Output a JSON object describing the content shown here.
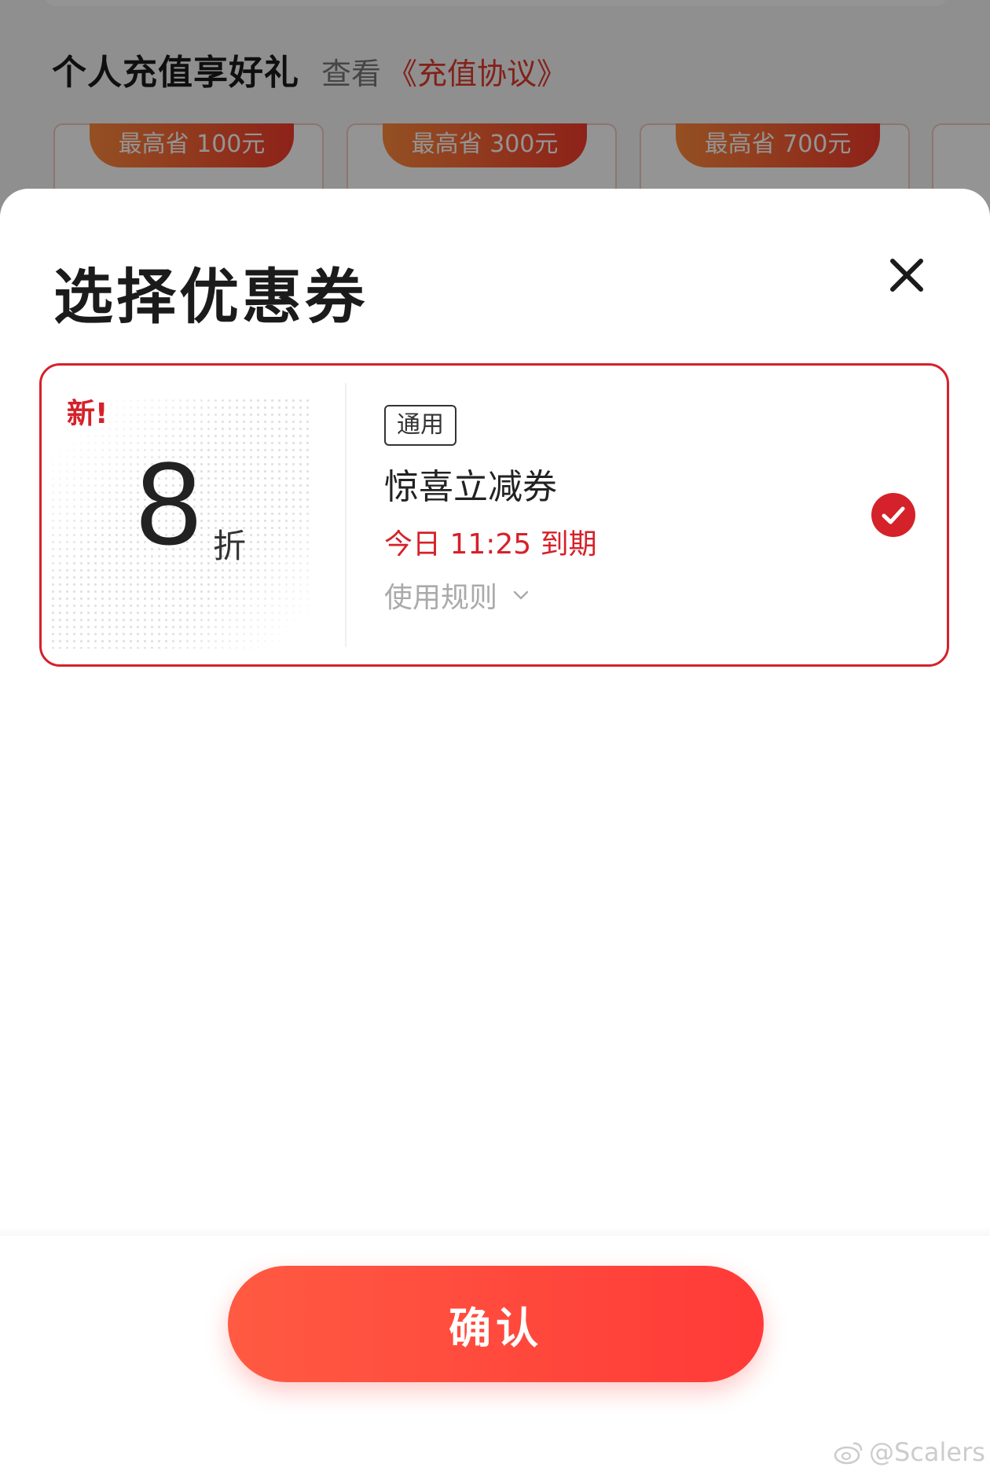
{
  "background_page": {
    "section_title": "个人充值享好礼",
    "view_label": "查看",
    "agreement_link": "《充值协议》",
    "offers": [
      {
        "ribbon": "最高省 100元"
      },
      {
        "ribbon": "最高省 300元"
      },
      {
        "ribbon": "最高省 700元"
      }
    ]
  },
  "sheet": {
    "title": "选择优惠券",
    "close_icon": "close-icon"
  },
  "coupon": {
    "new_badge": "新!",
    "discount_value": "8",
    "discount_unit": "折",
    "tag": "通用",
    "name": "惊喜立减券",
    "expiry": "今日 11:25 到期",
    "rules_label": "使用规则",
    "selected": true
  },
  "footer": {
    "confirm_label": "确认"
  },
  "watermark": {
    "text": "@Scalers"
  },
  "colors": {
    "accent_red": "#d5212a",
    "button_gradient_start": "#ff5a42",
    "button_gradient_end": "#ff3a38",
    "muted_text": "#aaaaaa"
  }
}
